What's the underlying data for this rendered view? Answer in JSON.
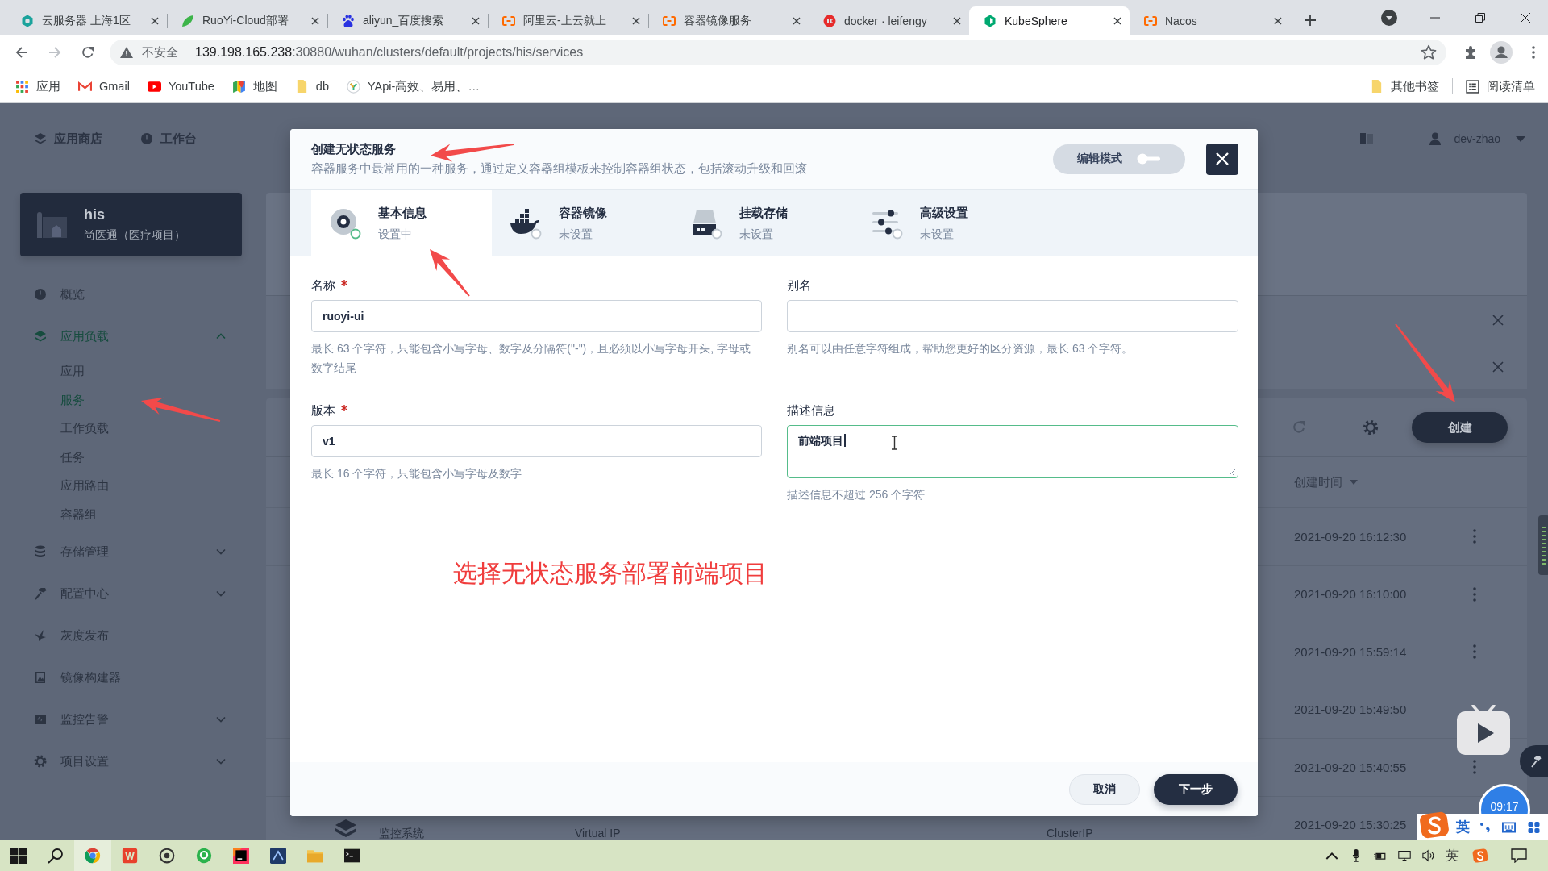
{
  "browser": {
    "tabs": [
      {
        "title": "云服务器 上海1区",
        "selected": false
      },
      {
        "title": "RuoYi-Cloud部署",
        "selected": false
      },
      {
        "title": "aliyun_百度搜索",
        "selected": false
      },
      {
        "title": "阿里云-上云就上",
        "selected": false
      },
      {
        "title": "容器镜像服务",
        "selected": false
      },
      {
        "title": "docker · leifengy",
        "selected": false
      },
      {
        "title": "KubeSphere",
        "selected": true
      },
      {
        "title": "Nacos",
        "selected": false
      }
    ],
    "security_label": "不安全",
    "url_host": "139.198.165.238",
    "url_path": ":30880/wuhan/clusters/default/projects/his/services",
    "bookmarks": [
      "应用",
      "Gmail",
      "YouTube",
      "地图",
      "db",
      "YApi-高效、易用、…"
    ],
    "other_bookmarks": "其他书签",
    "reading_list": "阅读清单"
  },
  "page": {
    "top_nav": [
      "应用商店",
      "工作台"
    ],
    "user": "dev-zhao",
    "project": {
      "name": "his",
      "description": "尚医通（医疗项目）"
    },
    "sidebar": [
      {
        "label": "概览",
        "selected": false
      },
      {
        "label": "应用负载",
        "selected": true,
        "expanded": true,
        "children": [
          {
            "label": "应用",
            "selected": false
          },
          {
            "label": "服务",
            "selected": true
          },
          {
            "label": "工作负载",
            "selected": false
          },
          {
            "label": "任务",
            "selected": false
          },
          {
            "label": "应用路由",
            "selected": false
          },
          {
            "label": "容器组",
            "selected": false
          }
        ]
      },
      {
        "label": "存储管理",
        "selected": false,
        "expanded": false
      },
      {
        "label": "配置中心",
        "selected": false,
        "expanded": false
      },
      {
        "label": "灰度发布",
        "selected": false
      },
      {
        "label": "镜像构建器",
        "selected": false
      },
      {
        "label": "监控告警",
        "selected": false,
        "expanded": false
      },
      {
        "label": "项目设置",
        "selected": false,
        "expanded": false
      }
    ],
    "services": {
      "create_button": "创建",
      "sort_column": "创建时间",
      "rows": [
        {
          "created": "2021-09-20 16:12:30"
        },
        {
          "created": "2021-09-20 16:10:00"
        },
        {
          "created": "2021-09-20 15:59:14"
        },
        {
          "created": "2021-09-20 15:49:50"
        },
        {
          "created": "2021-09-20 15:40:55"
        },
        {
          "description": "监控系统",
          "column_2": "Virtual IP",
          "column_3": "ClusterIP",
          "created": "2021-09-20 15:30:25"
        }
      ]
    }
  },
  "modal": {
    "title": "创建无状态服务",
    "subtitle": "容器服务中最常用的一种服务，通过定义容器组模板来控制容器组状态，包括滚动升级和回滚",
    "edit_mode": {
      "label": "编辑模式",
      "on": false
    },
    "steps": [
      {
        "title": "基本信息",
        "status": "设置中",
        "selected": true
      },
      {
        "title": "容器镜像",
        "status": "未设置",
        "selected": false
      },
      {
        "title": "挂载存储",
        "status": "未设置",
        "selected": false
      },
      {
        "title": "高级设置",
        "status": "未设置",
        "selected": false
      }
    ],
    "fields": [
      {
        "kind": "input",
        "label": "名称",
        "required": true,
        "value": "ruoyi-ui",
        "focused": false,
        "hint": "最长 63 个字符，只能包含小写字母、数字及分隔符(\"-\")，且必须以小写字母开头, 字母或数字结尾"
      },
      {
        "kind": "input",
        "label": "别名",
        "required": false,
        "focused": false,
        "hint": "别名可以由任意字符组成，帮助您更好的区分资源，最长 63 个字符。"
      },
      {
        "kind": "input",
        "label": "版本",
        "required": true,
        "value": "v1",
        "focused": false,
        "hint": "最长 16 个字符，只能包含小写字母及数字"
      },
      {
        "kind": "textarea",
        "label": "描述信息",
        "required": false,
        "value": "前端项目",
        "focused": true,
        "hint": "描述信息不超过 256 个字符"
      }
    ],
    "cancel_button": "取消",
    "next_button": "下一步"
  },
  "annotation": {
    "text": "选择无状态服务部署前端项目"
  },
  "overlays": {
    "clock": "09:17",
    "ime_mode": "英"
  },
  "taskbar": {
    "ime_indicator": "英"
  }
}
